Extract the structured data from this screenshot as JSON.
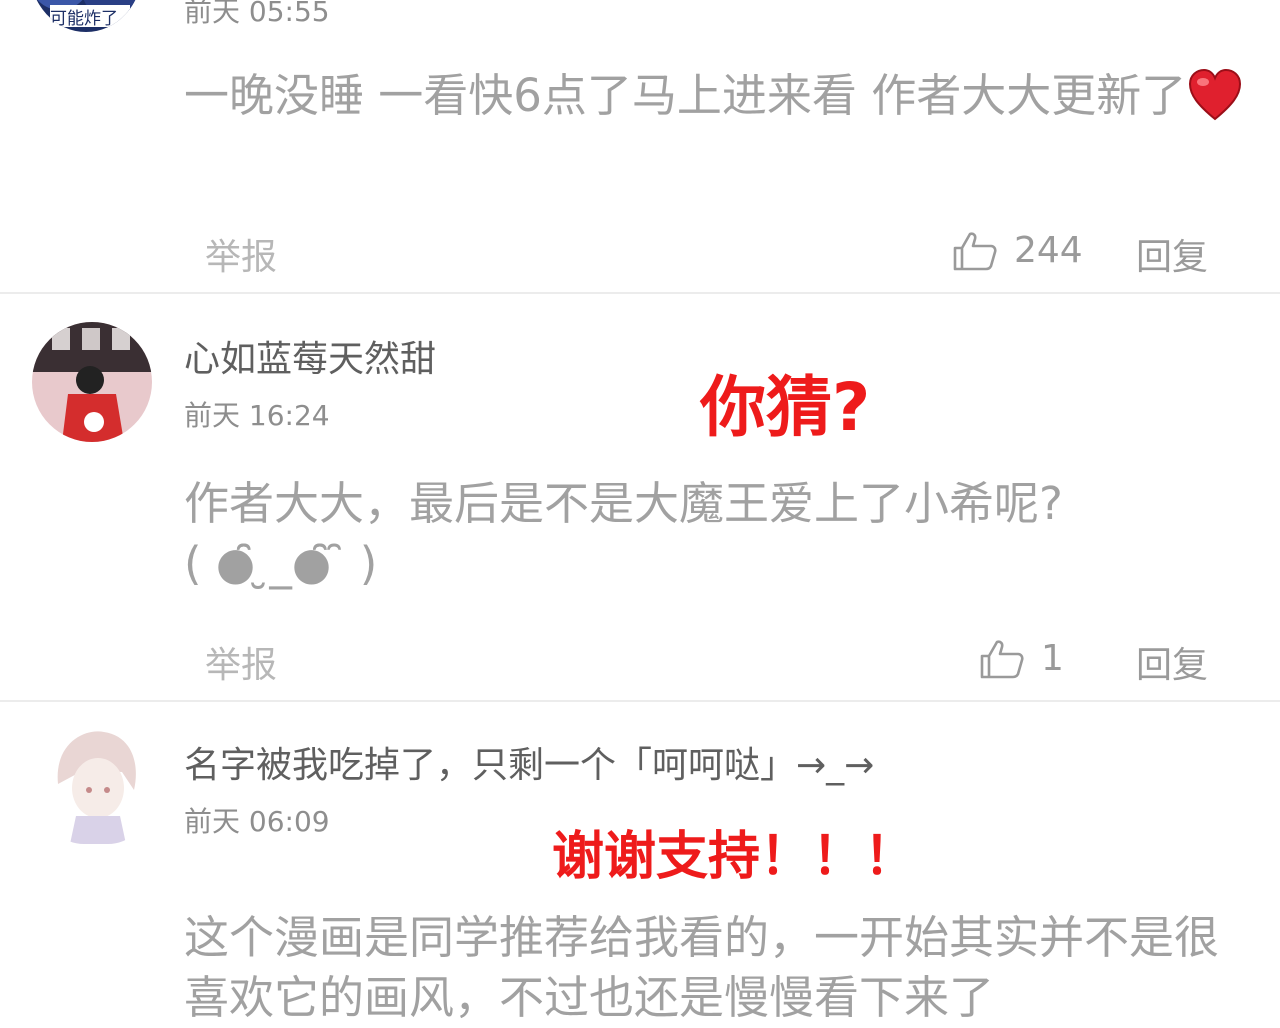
{
  "comments": [
    {
      "time": "前天 05:55",
      "content": "一晚没睡 一看快6点了马上进来看 作者大大更新了",
      "emoji": "heart-emoji",
      "report_label": "举报",
      "like_count": "244",
      "reply_label": "回复",
      "avatar_text": "可能炸了"
    },
    {
      "username": "心如蓝莓天然甜",
      "time": "前天 16:24",
      "content": "作者大大，最后是不是大魔王爱上了小希呢?",
      "content_line2": "( ●̑̑ ̮_●̑̑ ̑ )",
      "report_label": "举报",
      "like_count": "1",
      "reply_label": "回复"
    },
    {
      "username": "名字被我吃掉了，只剩一个「呵呵哒」→_→",
      "time": "前天 06:09",
      "content": "这个漫画是同学推荐给我看的，一开始其实并不是很喜欢它的画风，不过也还是慢慢看下来了"
    }
  ],
  "overlays": {
    "reply_1": "你猜?",
    "reply_2": "谢谢支持！！！"
  },
  "colors": {
    "overlay_red": "#ee1b1b",
    "text_gray": "#a1a1a1",
    "divider": "#ececec"
  }
}
